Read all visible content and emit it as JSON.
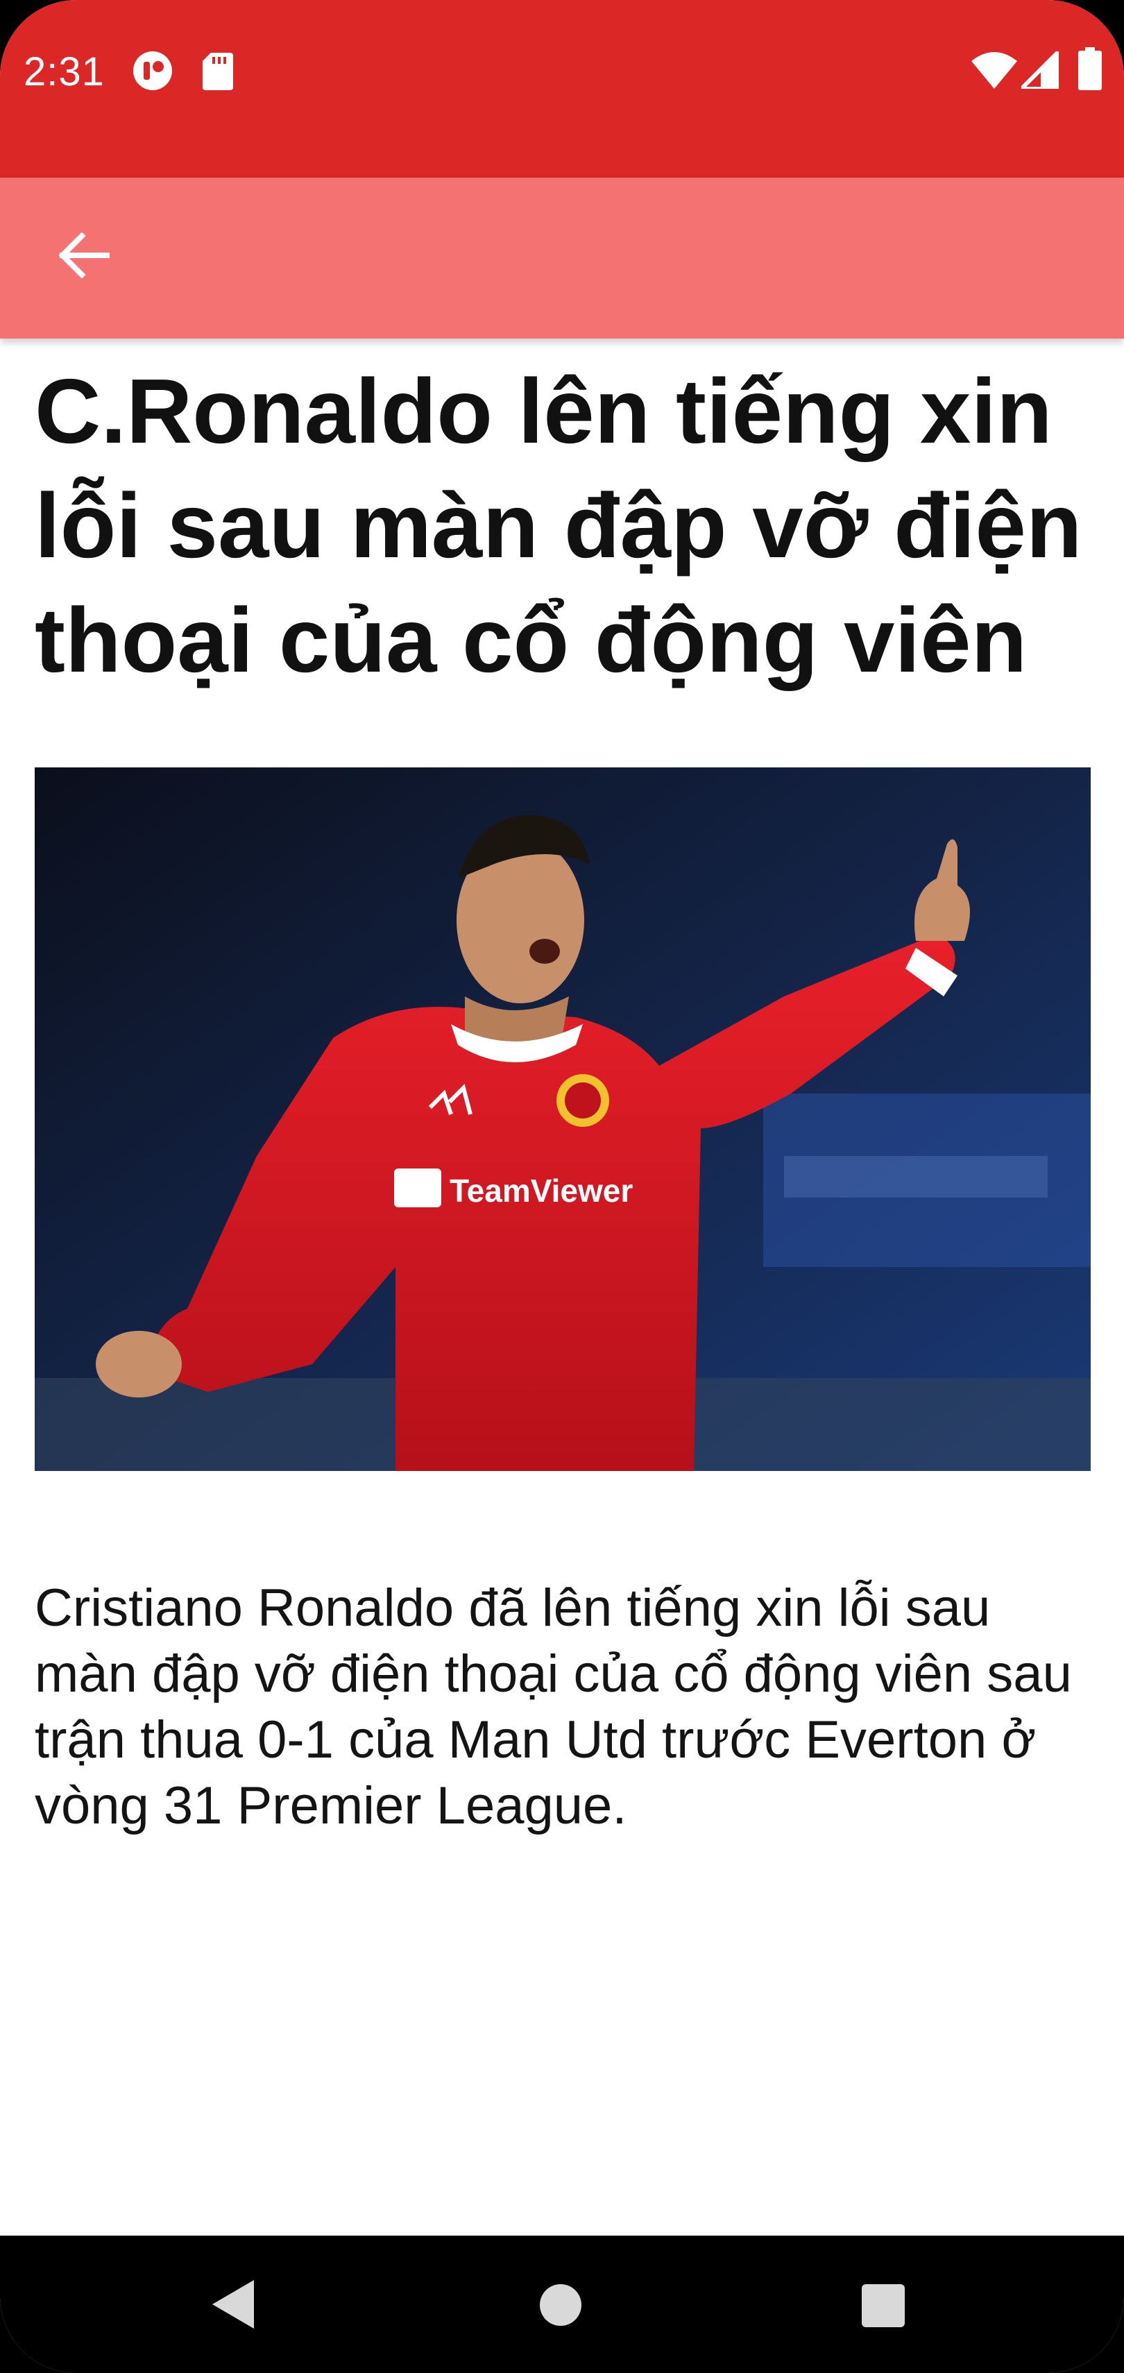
{
  "status_bar": {
    "time": "2:31",
    "background": "#dc2727",
    "left_icons": [
      "app-notification-icon",
      "sd-card-icon"
    ],
    "right_icons": [
      "wifi-icon",
      "cell-signal-icon",
      "battery-icon"
    ]
  },
  "app_bar": {
    "background": "#f47272",
    "back_icon": "arrow-left-icon"
  },
  "article": {
    "title": "C.Ronaldo lên tiếng xin lỗi sau màn đập vỡ điện thoại của cổ động viên",
    "image": {
      "kind": "photo",
      "shirt_text": "TeamViewer"
    },
    "summary": "Cristiano Ronaldo đã lên tiếng xin lỗi sau màn đập vỡ điện thoại của cổ động viên sau trận thua 0-1 của Man Utd trước Everton ở vòng 31 Premier League."
  },
  "nav_bar": {
    "buttons": [
      "back-triangle-icon",
      "home-circle-icon",
      "recents-square-icon"
    ]
  }
}
